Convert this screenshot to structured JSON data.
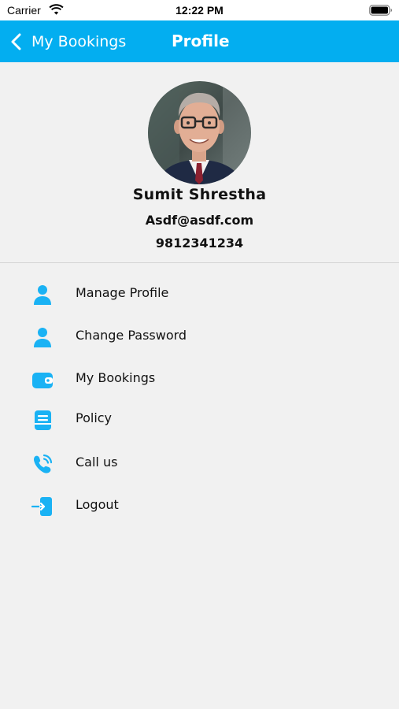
{
  "status_bar": {
    "carrier": "Carrier",
    "time": "12:22 PM",
    "wifi_icon": "wifi-icon",
    "battery_icon": "battery-icon"
  },
  "nav": {
    "back_label": "My Bookings",
    "back_icon": "chevron-left-icon",
    "title": "Profile",
    "bar_color": "#03aef0"
  },
  "profile": {
    "name": "Sumit  Shrestha",
    "email": "Asdf@asdf.com",
    "phone": "9812341234",
    "avatar_icon": "avatar-photo"
  },
  "menu": {
    "accent_color": "#1ab2f4",
    "items": [
      {
        "label": "Manage Profile",
        "icon": "person-icon"
      },
      {
        "label": "Change Password",
        "icon": "person-icon"
      },
      {
        "label": "My Bookings",
        "icon": "wallet-icon"
      },
      {
        "label": "Policy",
        "icon": "document-icon"
      },
      {
        "label": "Call us",
        "icon": "phone-icon"
      },
      {
        "label": "Logout",
        "icon": "logout-icon"
      }
    ]
  }
}
